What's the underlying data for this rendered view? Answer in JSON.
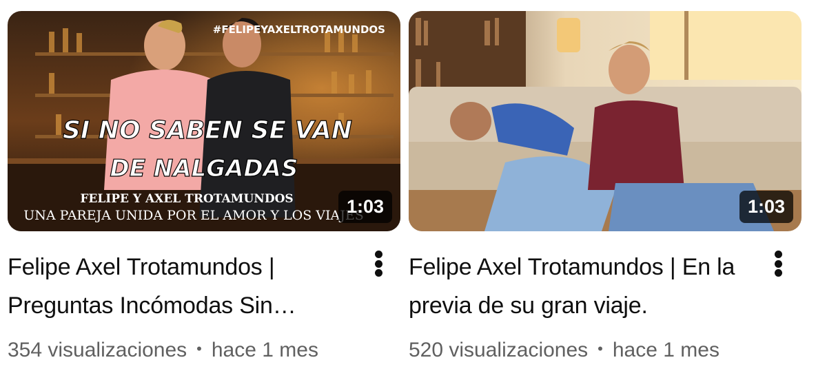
{
  "videos": [
    {
      "title": "Felipe Axel Trotamundos | Preguntas Incómodas Sin…",
      "duration": "1:03",
      "views": "354 visualizaciones",
      "age": "hace 1 mes",
      "thumbnail": {
        "hashtag": "#FELIPEYAXELTROTAMUNDOS",
        "headline_1": "SI NO SABEN SE VAN",
        "headline_2": "DE NALGADAS",
        "subtitle_1": "FELIPE Y AXEL TROTAMUNDOS",
        "subtitle_2": "UNA PAREJA UNIDA POR EL AMOR Y LOS VIAJES"
      },
      "menu_icon": "more-vertical-icon"
    },
    {
      "title": "Felipe Axel Trotamundos | En la previa de su gran viaje.",
      "duration": "1:03",
      "views": "520 visualizaciones",
      "age": "hace 1 mes",
      "menu_icon": "more-vertical-icon"
    }
  ],
  "meta_separator": "•",
  "colors": {
    "meta_text": "#606060",
    "title_text": "#0f0f0f",
    "duration_bg": "#000000"
  }
}
